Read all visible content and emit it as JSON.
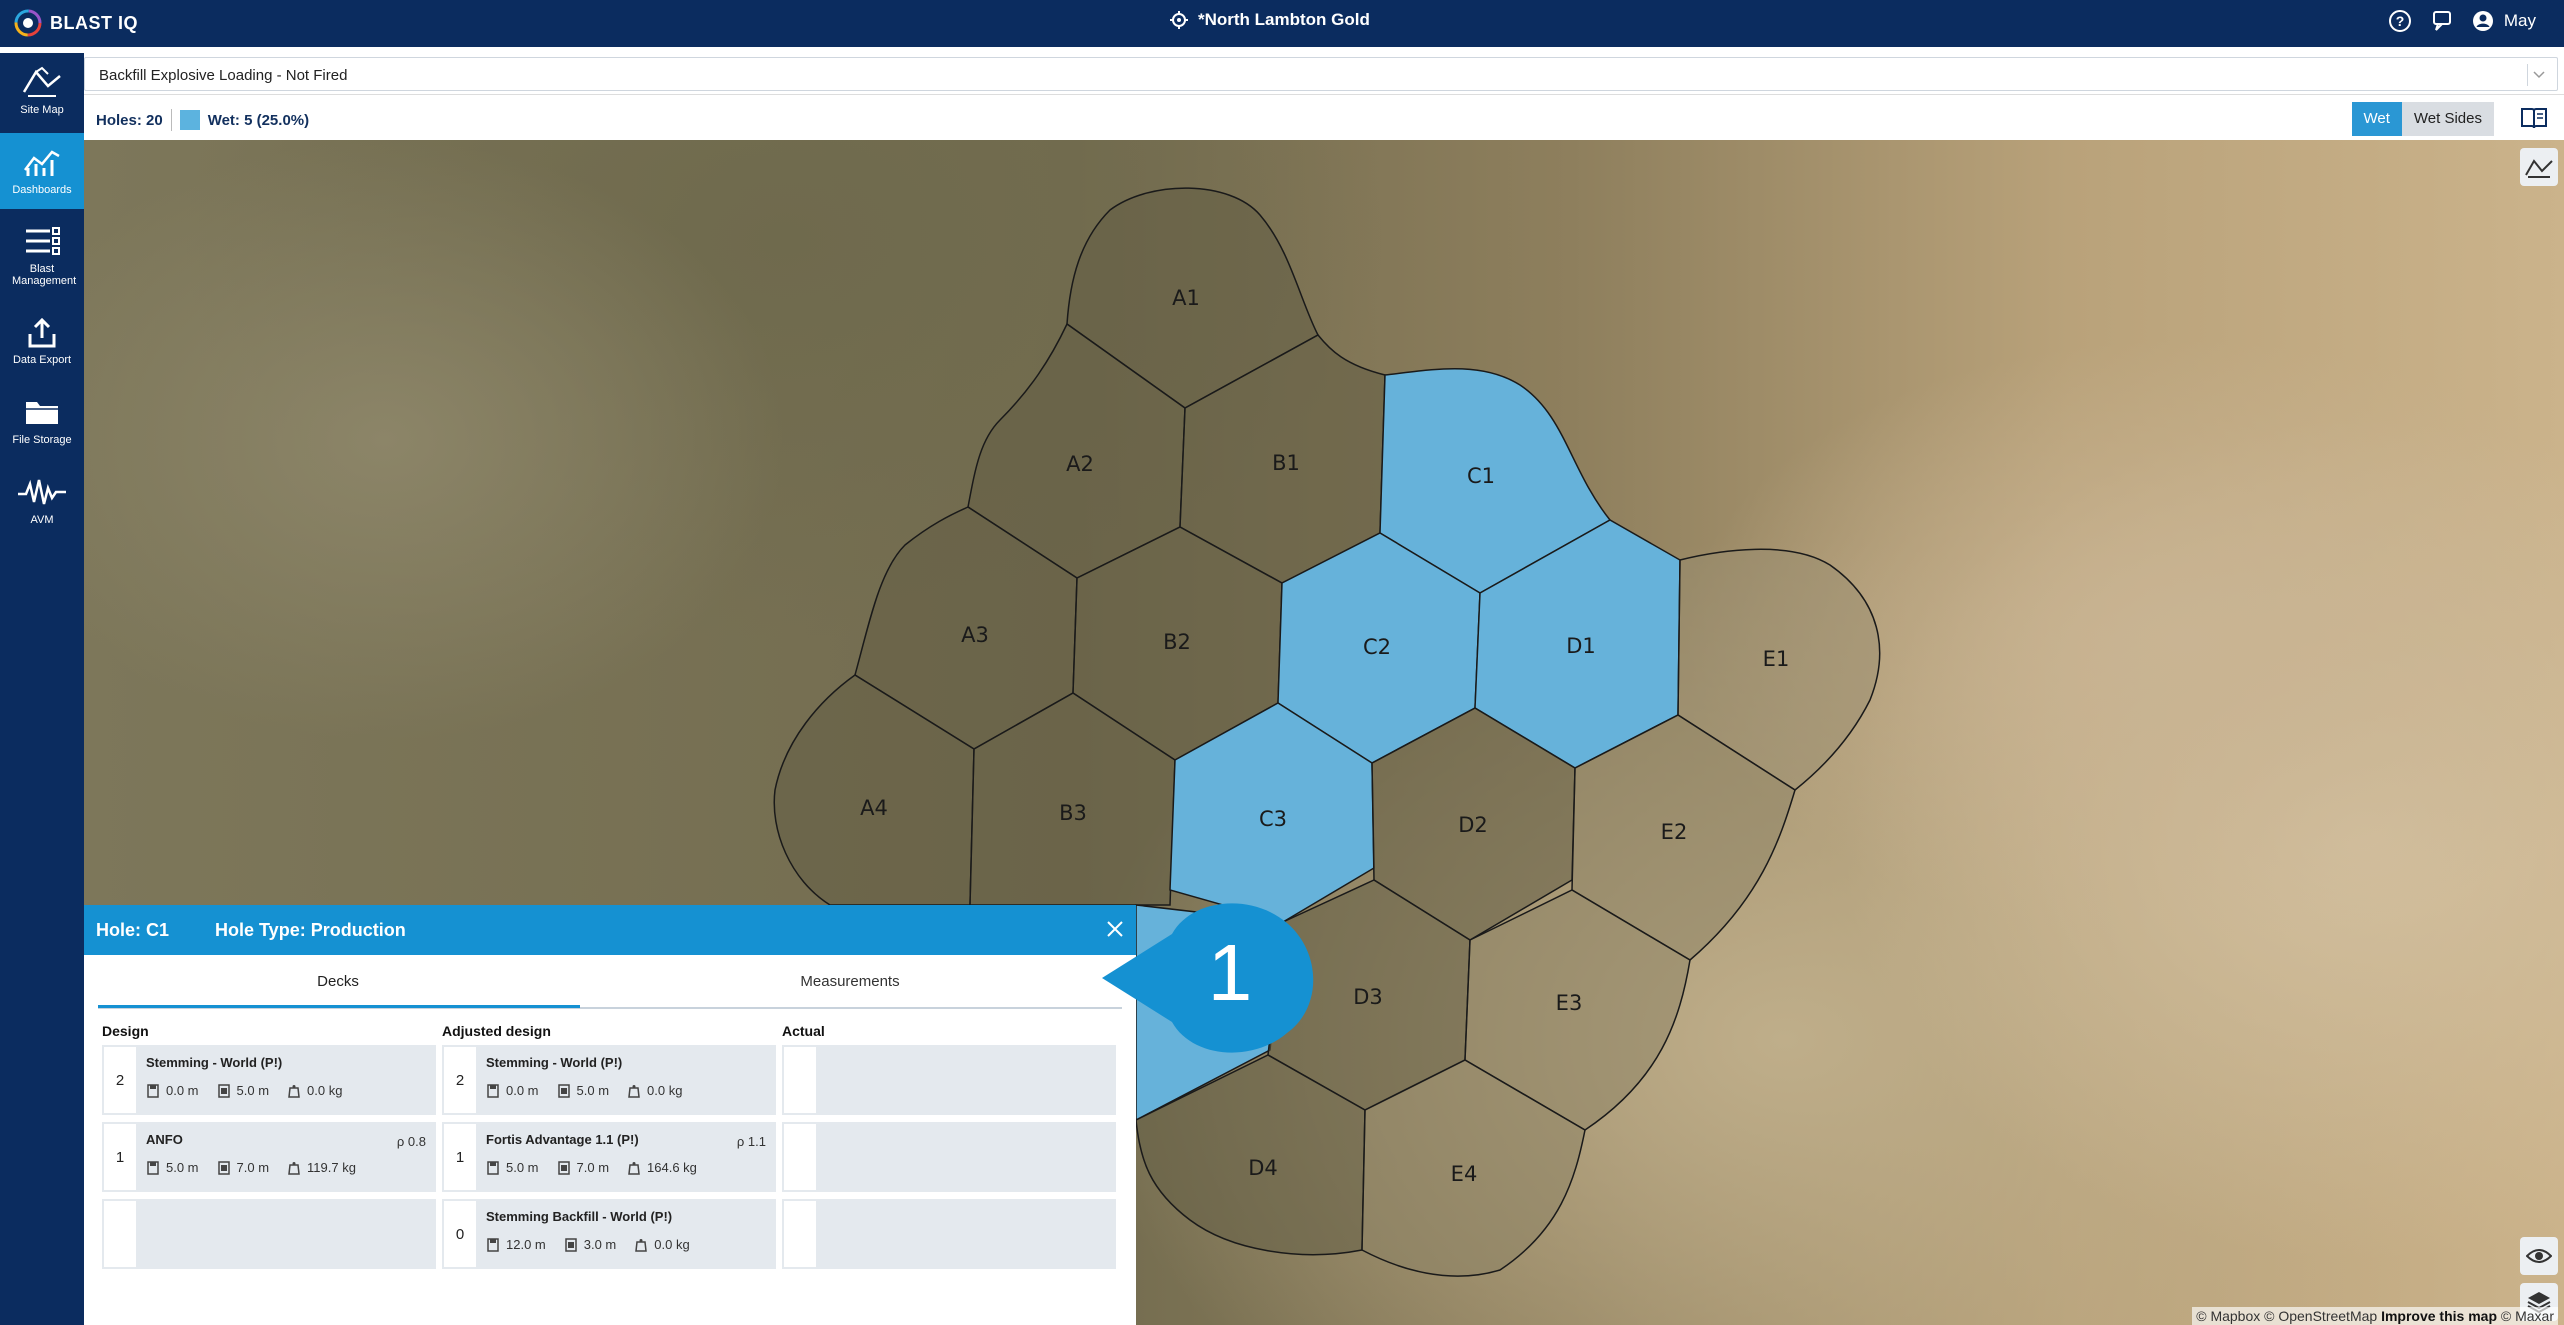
{
  "app": {
    "logo_text": "BLAST IQ",
    "site_name": "*North Lambton Gold",
    "user": "May"
  },
  "sidebar": {
    "items": [
      {
        "label": "Site Map",
        "icon": "site-map-icon"
      },
      {
        "label": "Dashboards",
        "icon": "dashboards-icon",
        "active": true
      },
      {
        "label": "Blast Management",
        "icon": "blast-management-icon"
      },
      {
        "label": "Data Export",
        "icon": "data-export-icon"
      },
      {
        "label": "File Storage",
        "icon": "file-storage-icon"
      },
      {
        "label": "AVM",
        "icon": "avm-icon"
      }
    ]
  },
  "filter": {
    "selected": "Backfill Explosive Loading - Not Fired"
  },
  "stats": {
    "holes": "Holes: 20",
    "wet": "Wet: 5 (25.0%)",
    "wet_color": "#5cb3df"
  },
  "view_toggle": {
    "options": [
      "Wet",
      "Wet Sides"
    ],
    "selected": "Wet"
  },
  "map": {
    "holes": [
      {
        "id": "A1",
        "wet": false
      },
      {
        "id": "A2",
        "wet": false
      },
      {
        "id": "A3",
        "wet": false
      },
      {
        "id": "A4",
        "wet": false
      },
      {
        "id": "B1",
        "wet": false
      },
      {
        "id": "B2",
        "wet": false
      },
      {
        "id": "B3",
        "wet": false
      },
      {
        "id": "C1",
        "wet": true
      },
      {
        "id": "C2",
        "wet": true
      },
      {
        "id": "C3",
        "wet": true
      },
      {
        "id": "D1",
        "wet": true
      },
      {
        "id": "D2",
        "wet": false
      },
      {
        "id": "D3",
        "wet": false
      },
      {
        "id": "D4",
        "wet": false
      },
      {
        "id": "E1",
        "wet": false
      },
      {
        "id": "E2",
        "wet": false
      },
      {
        "id": "E3",
        "wet": false
      },
      {
        "id": "E4",
        "wet": false
      }
    ],
    "attribution": {
      "mapbox": "© Mapbox",
      "osm": "© OpenStreetMap",
      "improve": "Improve this map",
      "maxar": "© Maxar"
    }
  },
  "panel": {
    "hole": "Hole: C1",
    "hole_type": "Hole Type: Production",
    "tabs": [
      "Decks",
      "Measurements"
    ],
    "selected_tab": "Decks",
    "columns": {
      "design": {
        "title": "Design",
        "decks": [
          {
            "num": "2",
            "name": "Stemming - World (P!)",
            "rho": "",
            "top": "0.0 m",
            "length": "5.0 m",
            "mass": "0.0 kg"
          },
          {
            "num": "1",
            "name": "ANFO",
            "rho": "ρ 0.8",
            "top": "5.0 m",
            "length": "7.0 m",
            "mass": "119.7 kg"
          }
        ]
      },
      "adjusted": {
        "title": "Adjusted design",
        "decks": [
          {
            "num": "2",
            "name": "Stemming - World (P!)",
            "rho": "",
            "top": "0.0 m",
            "length": "5.0 m",
            "mass": "0.0 kg"
          },
          {
            "num": "1",
            "name": "Fortis Advantage 1.1 (P!)",
            "rho": "ρ 1.1",
            "top": "5.0 m",
            "length": "7.0 m",
            "mass": "164.6 kg"
          },
          {
            "num": "0",
            "name": "Stemming Backfill - World (P!)",
            "rho": "",
            "top": "12.0 m",
            "length": "3.0 m",
            "mass": "0.0 kg"
          }
        ]
      },
      "actual": {
        "title": "Actual"
      }
    }
  },
  "callout": {
    "number": "1",
    "color": "#1591d2"
  }
}
